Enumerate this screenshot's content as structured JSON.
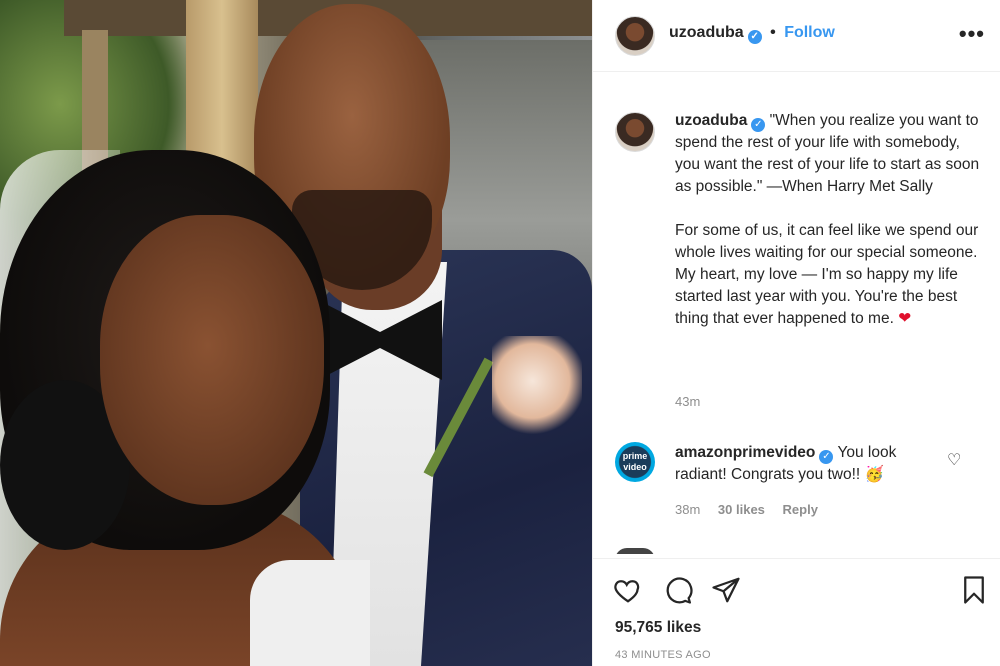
{
  "post": {
    "image_alt": "Couple selfie: bride with braided hair and veil, groom in navy suit with black bow tie",
    "header": {
      "username": "uzoaduba",
      "verified": true,
      "separator": "•",
      "follow_label": "Follow",
      "more_icon": "more-horizontal-icon"
    },
    "caption": {
      "username": "uzoaduba",
      "text": "\"When you realize you want to spend the rest of your life with somebody, you want the rest of your life to start as soon as possible.\" —When Harry Met Sally\n\nFor some of us, it can feel like we spend our whole lives waiting for our special someone. My heart, my love — I'm so happy my life started last year with you. You're the best thing that ever happened to me.",
      "emoji": "❤",
      "time": "43m"
    },
    "comments": [
      {
        "username": "amazonprimevideo",
        "avatar_text": "prime video",
        "text": "You look radiant! Congrats you two!!",
        "emoji": "🥳",
        "time": "38m",
        "likes": "30 likes",
        "reply_label": "Reply"
      }
    ],
    "actions": {
      "like_icon": "heart-outline-icon",
      "comment_icon": "comment-bubble-icon",
      "share_icon": "paper-plane-icon",
      "save_icon": "bookmark-icon"
    },
    "likes": "95,765 likes",
    "timestamp": "43 MINUTES AGO"
  },
  "colors": {
    "link_blue": "#3897f0",
    "secondary_text": "#8e8e8e",
    "border": "#efefef",
    "heart_red": "#e0102c"
  }
}
